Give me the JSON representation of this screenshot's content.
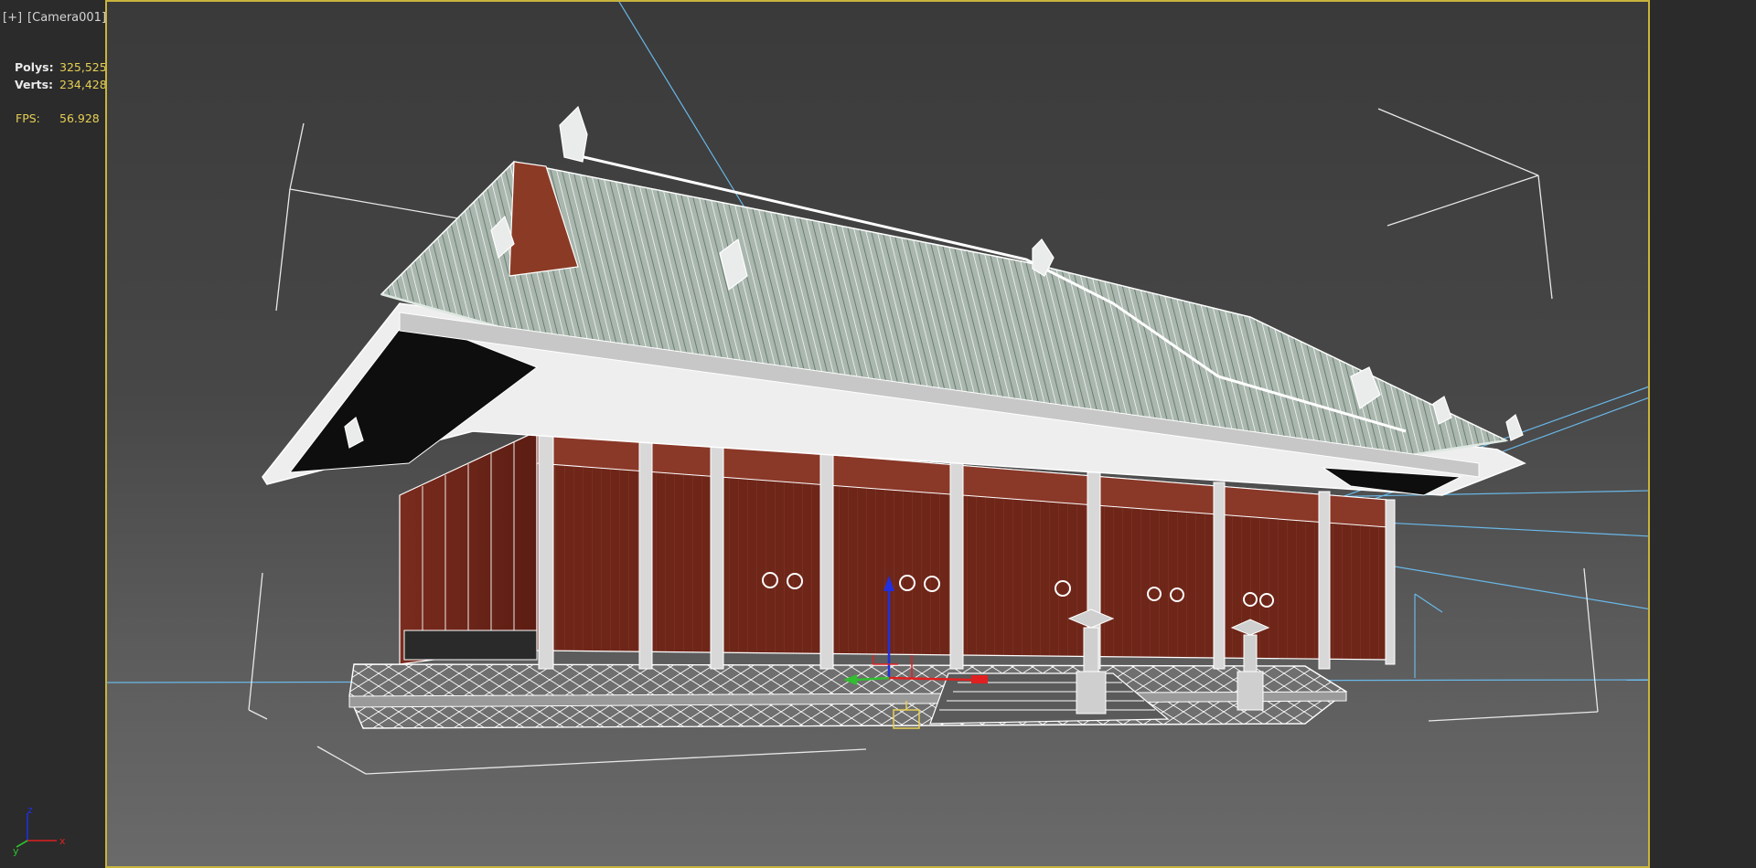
{
  "viewport": {
    "plus_menu": "[+]",
    "camera_menu": "[Camera001]"
  },
  "stats": {
    "polys_label": "Polys:",
    "polys_value": "325,525",
    "verts_label": "Verts:",
    "verts_value": "234,428",
    "fps_label": "FPS:",
    "fps_value": "56.928"
  },
  "axis_tripod": {
    "x_label": "x",
    "y_label": "y",
    "z_label": "z"
  },
  "colors": {
    "frame_border": "#c8b43c",
    "stat_value": "#e6cf55",
    "gizmo_x": "#e02020",
    "gizmo_y": "#2fbf2f",
    "gizmo_z": "#2030e0",
    "camera_lines": "#6ab8e8"
  }
}
